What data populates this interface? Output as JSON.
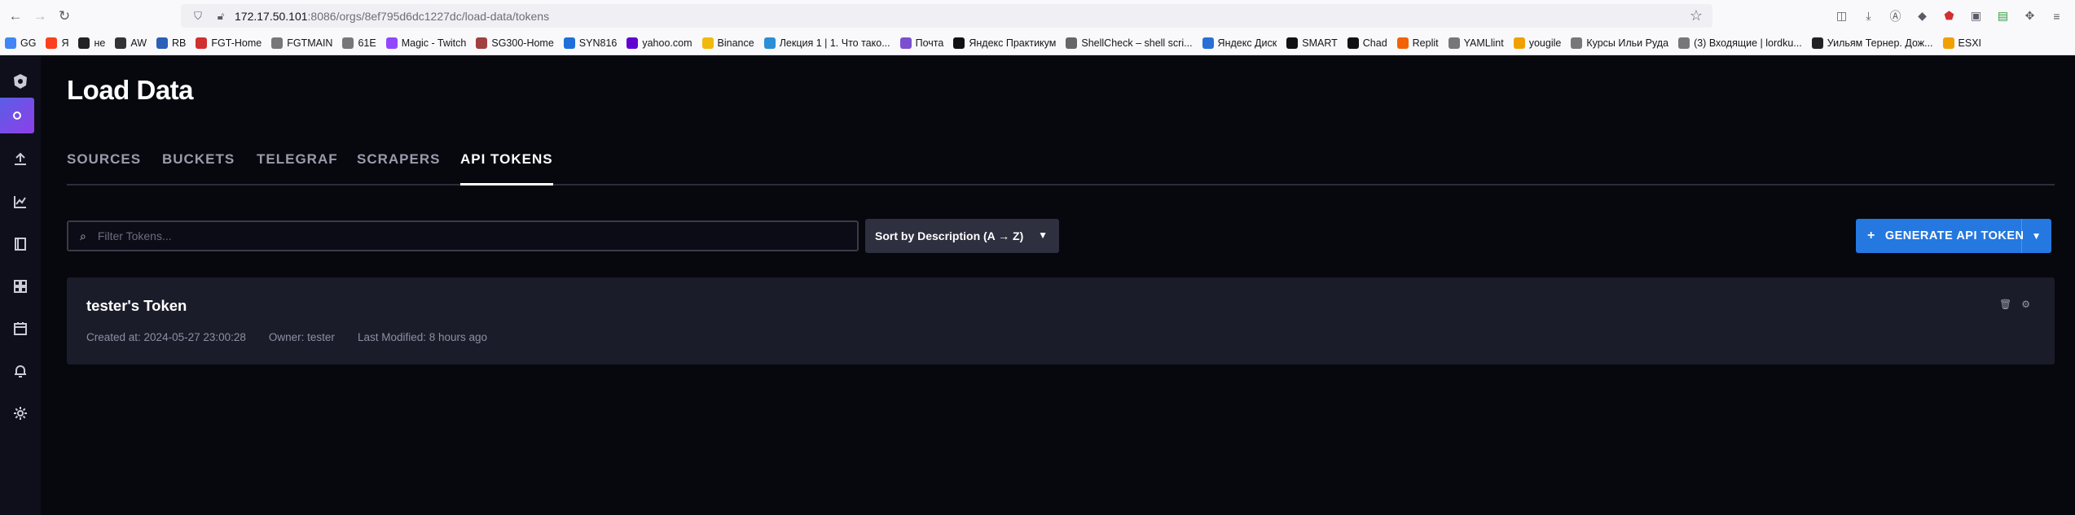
{
  "browser": {
    "url_host": "172.17.50.101",
    "url_path": ":8086/orgs/8ef795d6dc1227dc/load-data/tokens",
    "bookmarks": [
      {
        "label": "GG",
        "color": "#4285f4"
      },
      {
        "label": "Я",
        "color": "#fc3f1d"
      },
      {
        "label": "не",
        "color": "#222222"
      },
      {
        "label": "AW",
        "color": "#333333"
      },
      {
        "label": "RB",
        "color": "#2b5fb8"
      },
      {
        "label": "FGT-Home",
        "color": "#d03030"
      },
      {
        "label": "FGTMAIN",
        "color": "#777777"
      },
      {
        "label": "61E",
        "color": "#777777"
      },
      {
        "label": "Magic - Twitch",
        "color": "#9146ff"
      },
      {
        "label": "SG300-Home",
        "color": "#a04040"
      },
      {
        "label": "SYN816",
        "color": "#1e6fd9"
      },
      {
        "label": "yahoo.com",
        "color": "#6001d2"
      },
      {
        "label": "Binance",
        "color": "#f0b90b"
      },
      {
        "label": "Лекция 1 | 1. Что тако...",
        "color": "#2a8fd6"
      },
      {
        "label": "Почта",
        "color": "#7b4fd0"
      },
      {
        "label": "Яндекс Практикум",
        "color": "#111111"
      },
      {
        "label": "ShellCheck – shell scri...",
        "color": "#666666"
      },
      {
        "label": "Яндекс Диск",
        "color": "#2a6fd6"
      },
      {
        "label": "SMART",
        "color": "#111111"
      },
      {
        "label": "Chad",
        "color": "#111111"
      },
      {
        "label": "Replit",
        "color": "#f26207"
      },
      {
        "label": "YAMLlint",
        "color": "#777777"
      },
      {
        "label": "yougile",
        "color": "#f0a000"
      },
      {
        "label": "Курсы Ильи Руда",
        "color": "#777777"
      },
      {
        "label": "(3) Входящие | lordku...",
        "color": "#777777"
      },
      {
        "label": "Уильям Тернер. Дож...",
        "color": "#222222"
      },
      {
        "label": "ESXI",
        "color": "#f0a000"
      }
    ]
  },
  "page": {
    "title": "Load Data",
    "tabs": [
      "SOURCES",
      "BUCKETS",
      "TELEGRAF",
      "SCRAPERS",
      "API TOKENS"
    ],
    "active_tab": "API TOKENS"
  },
  "controls": {
    "filter_placeholder": "Filter Tokens...",
    "sort_label": "Sort by Description (A → Z)",
    "generate_label": "GENERATE API TOKEN"
  },
  "tokens": [
    {
      "name": "tester's Token",
      "created": "Created at: 2024-05-27 23:00:28",
      "owner": "Owner: tester",
      "modified": "Last Modified: 8 hours ago"
    }
  ],
  "colors": {
    "accent": "#2478e0",
    "nav_active": "#6a4ee8",
    "background": "#07070e",
    "card": "#1b1c29"
  }
}
